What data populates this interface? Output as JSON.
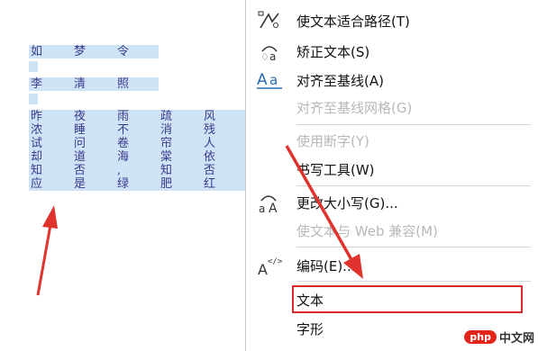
{
  "canvas": {
    "rows": [
      [
        "如",
        "梦",
        "令"
      ],
      [
        "李",
        "清",
        "照"
      ],
      [
        "昨",
        "夜",
        "雨",
        "疏",
        "风"
      ],
      [
        "浓",
        "睡",
        "不",
        "消",
        "残"
      ],
      [
        "试",
        "问",
        "卷",
        "帘",
        "人"
      ],
      [
        "却",
        "道",
        "海",
        "棠",
        "依"
      ],
      [
        "知",
        "否",
        ",",
        "知",
        "否"
      ],
      [
        "应",
        "是",
        "绿",
        "肥",
        "红"
      ]
    ]
  },
  "menu": {
    "items": [
      {
        "label": "使文本适合路径(T)",
        "icon": "text-on-path-icon",
        "enabled": true
      },
      {
        "label": "矫正文本(S)",
        "icon": "straighten-text-icon",
        "enabled": true
      },
      {
        "label": "对齐至基线(A)",
        "icon": "align-baseline-icon",
        "enabled": true
      },
      {
        "label": "对齐至基线网格(G)",
        "icon": "",
        "enabled": false
      },
      {
        "label": "使用断字(Y)",
        "icon": "",
        "enabled": false
      },
      {
        "label": "书写工具(W)",
        "icon": "",
        "enabled": true
      },
      {
        "label": "更改大小写(G)...",
        "icon": "change-case-icon",
        "enabled": true
      },
      {
        "label": "使文本与 Web 兼容(M)",
        "icon": "",
        "enabled": false
      },
      {
        "label": "编码(E)...",
        "icon": "encoding-icon",
        "enabled": true
      },
      {
        "label": "文本",
        "icon": "",
        "enabled": true,
        "highlighted": true
      },
      {
        "label": "字形",
        "icon": "",
        "enabled": true
      }
    ]
  },
  "watermark": {
    "logo": "php",
    "site": "中文网"
  },
  "colors": {
    "selection": "#cfe3f6",
    "arrow": "#e0332e",
    "highlight": "#d62a2a"
  }
}
